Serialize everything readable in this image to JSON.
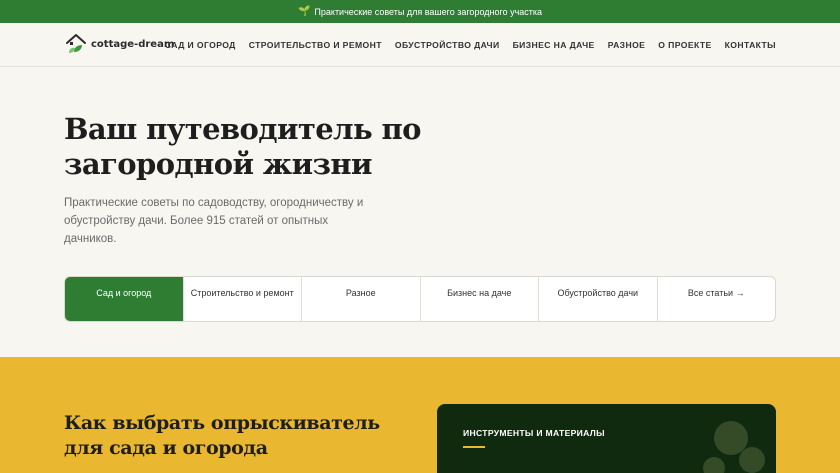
{
  "topbar": {
    "text": "Практические советы для вашего загородного участка"
  },
  "logo": {
    "text": "cottage-dream"
  },
  "nav": {
    "items": [
      "САД И ОГОРОД",
      "СТРОИТЕЛЬСТВО И РЕМОНТ",
      "ОБУСТРОЙСТВО ДАЧИ",
      "БИЗНЕС НА ДАЧЕ",
      "РАЗНОЕ",
      "О ПРОЕКТЕ",
      "КОНТАКТЫ"
    ]
  },
  "hero": {
    "title": "Ваш путеводитель по загородной жизни",
    "subtitle": "Практические советы по садоводству, огородничеству и обустройству дачи. Более 915 статей от опытных дачников."
  },
  "tabs": [
    "Сад и огород",
    "Строительство и ремонт",
    "Разное",
    "Бизнес на даче",
    "Обустройство дачи",
    "Все статьи →"
  ],
  "featured": {
    "title": "Как выбрать опрыскиватель для сада и огорода",
    "card_label": "ИНСТРУМЕНТЫ И МАТЕРИАЛЫ"
  },
  "colors": {
    "brand_green": "#2f7d32",
    "accent_yellow": "#e9b830",
    "dark_card": "#0f2a0f"
  }
}
